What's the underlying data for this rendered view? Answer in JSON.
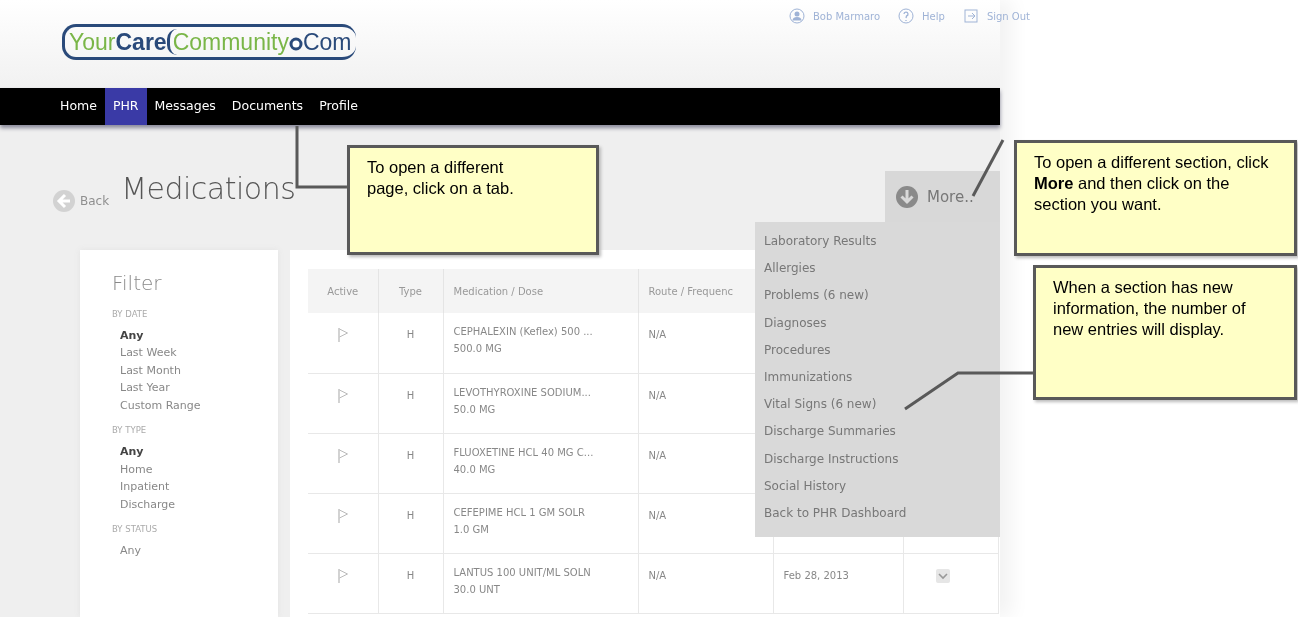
{
  "logo": {
    "parts": [
      "Your",
      "Care",
      "Community",
      "Com"
    ]
  },
  "top_links": [
    {
      "kind": "user",
      "label": "Bob Marmaro"
    },
    {
      "kind": "help",
      "label": "Help"
    },
    {
      "kind": "signout",
      "label": "Sign Out"
    }
  ],
  "tabs": [
    {
      "label": "Home",
      "selected": false
    },
    {
      "label": "PHR",
      "selected": true
    },
    {
      "label": "Messages",
      "selected": false
    },
    {
      "label": "Documents",
      "selected": false
    },
    {
      "label": "Profile",
      "selected": false
    }
  ],
  "back": {
    "label": "Back"
  },
  "page_title": "Medications",
  "more": {
    "label": "More..",
    "expanded": true
  },
  "more_menu": [
    "Laboratory Results",
    "Allergies",
    "Problems (6 new)",
    "Diagnoses",
    "Procedures",
    "Immunizations",
    "Vital Signs (6 new)",
    "Discharge Summaries",
    "Discharge Instructions",
    "Social History",
    "Back to PHR Dashboard"
  ],
  "filter": {
    "title": "Filter",
    "groups": [
      {
        "heading": "BY DATE",
        "options": [
          {
            "label": "Any",
            "selected": true
          },
          {
            "label": "Last Week",
            "selected": false
          },
          {
            "label": "Last Month",
            "selected": false
          },
          {
            "label": "Last Year",
            "selected": false
          },
          {
            "label": "Custom Range",
            "selected": false
          }
        ]
      },
      {
        "heading": "BY TYPE",
        "options": [
          {
            "label": "Any",
            "selected": true
          },
          {
            "label": "Home",
            "selected": false
          },
          {
            "label": "Inpatient",
            "selected": false
          },
          {
            "label": "Discharge",
            "selected": false
          }
        ]
      },
      {
        "heading": "BY STATUS",
        "options": [
          {
            "label": "Any",
            "selected": false
          }
        ]
      }
    ]
  },
  "table": {
    "columns": [
      "Active",
      "Type",
      "Medication / Dose",
      "Route / Frequenc"
    ],
    "rows": [
      {
        "type": "H",
        "medication": "CEPHALEXIN (Keflex) 500 ...",
        "dose": "500.0 MG",
        "route": "N/A"
      },
      {
        "type": "H",
        "medication": "LEVOTHYROXINE SODIUM...",
        "dose": "50.0 MG",
        "route": "N/A"
      },
      {
        "type": "H",
        "medication": "FLUOXETINE HCL 40 MG C...",
        "dose": "40.0 MG",
        "route": "N/A"
      },
      {
        "type": "H",
        "medication": "CEFEPIME HCL 1 GM SOLR",
        "dose": "1.0 GM",
        "route": "N/A"
      },
      {
        "type": "H",
        "medication": "LANTUS 100 UNIT/ML SOLN",
        "dose": "30.0 UNT",
        "route": "N/A",
        "date": "Feb 28, 2013"
      }
    ]
  },
  "callouts": [
    {
      "kind": "tabs",
      "text": "To open a different page, click on a tab."
    },
    {
      "kind": "more",
      "text": "To open a different section, click **More** and then click on the section you want."
    },
    {
      "kind": "menu",
      "text": "When a section has new information, the number of new entries will display."
    }
  ]
}
